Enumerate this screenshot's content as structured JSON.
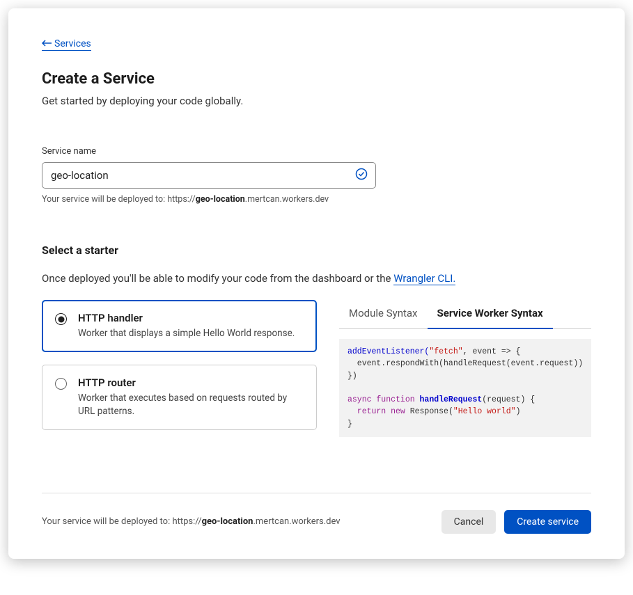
{
  "back_link": "Services",
  "title": "Create a Service",
  "subtitle": "Get started by deploying your code globally.",
  "service_name": {
    "label": "Service name",
    "value": "geo-location",
    "helper_prefix": "Your service will be deployed to: https://",
    "helper_bold": "geo-location",
    "helper_suffix": ".mertcan.workers.dev"
  },
  "starter": {
    "heading": "Select a starter",
    "text_prefix": "Once deployed you'll be able to modify your code from the dashboard or the ",
    "link_text": "Wrangler CLI.",
    "options": [
      {
        "title": "HTTP handler",
        "desc": "Worker that displays a simple Hello World response.",
        "selected": true
      },
      {
        "title": "HTTP router",
        "desc": "Worker that executes based on requests routed by URL patterns.",
        "selected": false
      }
    ]
  },
  "tabs": [
    {
      "label": "Module Syntax",
      "active": false
    },
    {
      "label": "Service Worker Syntax",
      "active": true
    }
  ],
  "code": {
    "line1a": "addEventListener(",
    "line1b": "\"fetch\"",
    "line1c": ", event => {",
    "line2": "  event.respondWith(handleRequest(event.request))",
    "line3": "})",
    "blank": "",
    "line4a": "async function",
    "line4b": " handleRequest",
    "line4c": "(request) {",
    "line5a": "  return new",
    "line5b": " Response(",
    "line5c": "\"Hello world\"",
    "line5d": ")",
    "line6": "}"
  },
  "footer": {
    "text_prefix": "Your service will be deployed to: https://",
    "text_bold": "geo-location",
    "text_suffix": ".mertcan.workers.dev",
    "cancel": "Cancel",
    "create": "Create service"
  }
}
